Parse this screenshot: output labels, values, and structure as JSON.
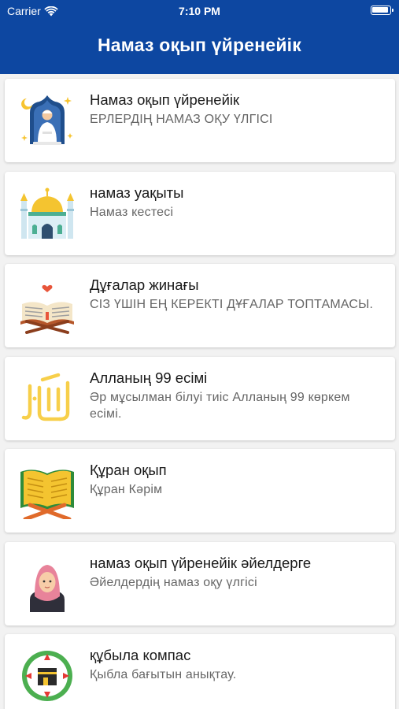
{
  "status_bar": {
    "carrier": "Carrier",
    "time": "7:10 PM"
  },
  "header": {
    "title": "Намаз оқып үйренейік"
  },
  "items": [
    {
      "title": "Намаз оқып үйренейік",
      "subtitle": "ЕРЛЕРДІҢ НАМАЗ ОҚУ ҮЛГІСІ",
      "icon": "praying-man-icon"
    },
    {
      "title": "намаз уақыты",
      "subtitle": "Намаз кестесі",
      "icon": "mosque-icon"
    },
    {
      "title": "Дұғалар жинағы",
      "subtitle": "СІЗ ҮШІН ЕҢ КЕРЕКТІ ДҰҒАЛАР ТОПТАМАСЫ.",
      "icon": "book-on-stand-icon"
    },
    {
      "title": "Алланың 99 есімі",
      "subtitle": "Әр мұсылман білуі тиіс Алланың 99 көркем есімі.",
      "icon": "allah-calligraphy-icon"
    },
    {
      "title": "Құран оқып",
      "subtitle": "Құран Кәрім",
      "icon": "quran-icon"
    },
    {
      "title": "намаз оқып үйренейік әйелдерге",
      "subtitle": "Әйелдердің намаз оқу үлгісі",
      "icon": "hijab-woman-icon"
    },
    {
      "title": "құбыла компас",
      "subtitle": "Қыбла бағытын анықтау.",
      "icon": "qibla-compass-icon"
    }
  ]
}
